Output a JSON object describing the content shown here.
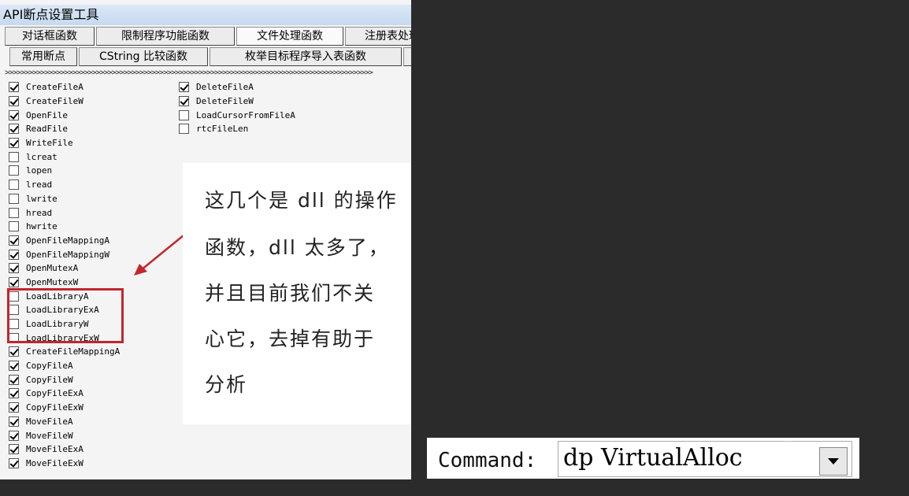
{
  "window": {
    "title": "API断点设置工具"
  },
  "tabs_row1": [
    {
      "label": "对话框函数"
    },
    {
      "label": "限制程序功能函数"
    },
    {
      "label": "文件处理函数"
    },
    {
      "label": "注册表处理"
    }
  ],
  "tabs_row2": [
    {
      "label": "常用断点"
    },
    {
      "label": "CString 比较函数"
    },
    {
      "label": "枚举目标程序导入表函数"
    },
    {
      "label": ""
    }
  ],
  "separator": ">>>>>>>>>>>>>>>>>>>>>>>>>>>>>>>>>>>>>>>>>>>>>>>>>>>>>>>>>>>>>>>>>>>>>>>>>>>>>>>>>>>>>>>>>>>>>",
  "col1": [
    {
      "label": "CreateFileA",
      "checked": true
    },
    {
      "label": "CreateFileW",
      "checked": true
    },
    {
      "label": "OpenFile",
      "checked": true
    },
    {
      "label": "ReadFile",
      "checked": true
    },
    {
      "label": "WriteFile",
      "checked": true
    },
    {
      "label": "lcreat",
      "checked": false
    },
    {
      "label": "lopen",
      "checked": false
    },
    {
      "label": "lread",
      "checked": false
    },
    {
      "label": "lwrite",
      "checked": false
    },
    {
      "label": "hread",
      "checked": false
    },
    {
      "label": "hwrite",
      "checked": false
    },
    {
      "label": "OpenFileMappingA",
      "checked": true
    },
    {
      "label": "OpenFileMappingW",
      "checked": true
    },
    {
      "label": "OpenMutexA",
      "checked": true
    },
    {
      "label": "OpenMutexW",
      "checked": true
    },
    {
      "label": "LoadLibraryA",
      "checked": false
    },
    {
      "label": "LoadLibraryExA",
      "checked": false
    },
    {
      "label": "LoadLibraryW",
      "checked": false
    },
    {
      "label": "LoadLibraryExW",
      "checked": false
    },
    {
      "label": "CreateFileMappingA",
      "checked": true
    },
    {
      "label": "CopyFileA",
      "checked": true
    },
    {
      "label": "CopyFileW",
      "checked": true
    },
    {
      "label": "CopyFileExA",
      "checked": true
    },
    {
      "label": "CopyFileExW",
      "checked": true
    },
    {
      "label": "MoveFileA",
      "checked": true
    },
    {
      "label": "MoveFileW",
      "checked": true
    },
    {
      "label": "MoveFileExA",
      "checked": true
    },
    {
      "label": "MoveFileExW",
      "checked": true
    }
  ],
  "col2": [
    {
      "label": "DeleteFileA",
      "checked": true
    },
    {
      "label": "DeleteFileW",
      "checked": true
    },
    {
      "label": "LoadCursorFromFileA",
      "checked": false
    },
    {
      "label": "rtcFileLen",
      "checked": false
    }
  ],
  "annotation": {
    "lines": [
      "这几个是 dll 的操作",
      "函数，dll 太多了，",
      "并且目前我们不关",
      "心它，去掉有助于",
      "分析"
    ]
  },
  "command": {
    "label": "Command:",
    "value": "dp VirtualAlloc"
  },
  "colors": {
    "highlight": "#c1272d",
    "background": "#2b2b2b"
  }
}
